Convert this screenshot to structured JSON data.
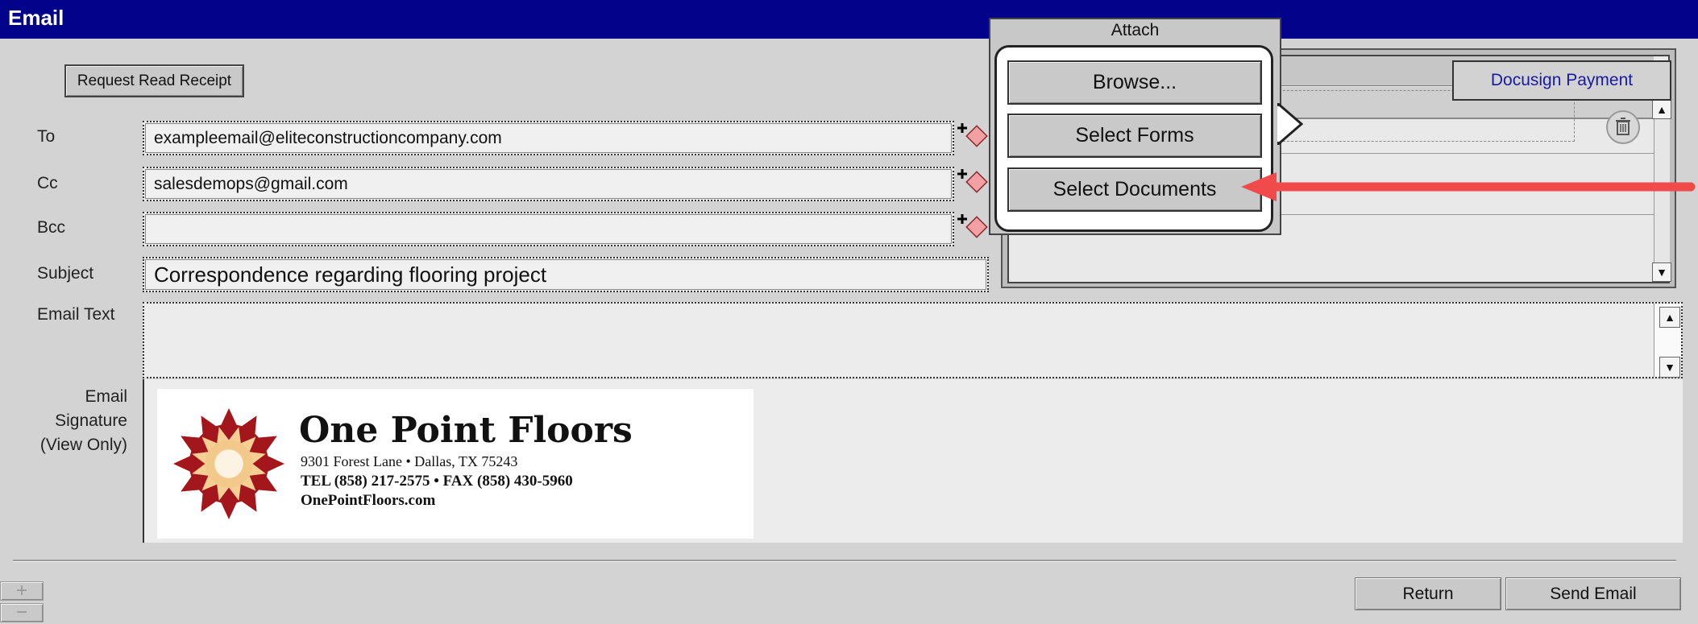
{
  "window": {
    "title": "Email"
  },
  "toolbar": {
    "read_receipt_label": "Request Read Receipt"
  },
  "fields": {
    "to": {
      "label": "To",
      "value": "exampleemail@eliteconstructioncompany.com"
    },
    "cc": {
      "label": "Cc",
      "value": "salesdemops@gmail.com"
    },
    "bcc": {
      "label": "Bcc",
      "value": ""
    },
    "subject": {
      "label": "Subject",
      "value": "Correspondence regarding flooring project"
    },
    "email_text": {
      "label": "Email Text",
      "value": ""
    }
  },
  "signature": {
    "label_line1": "Email",
    "label_line2": "Signature",
    "label_line3": "(View Only)",
    "company": "One Point Floors",
    "address": "9301 Forest Lane • Dallas, TX  75243",
    "phone_line": "TEL  (858) 217-2575 •  FAX (858) 430-5960",
    "website": "OnePointFloors.com"
  },
  "attachments": {
    "tab_label": "Docusign Payment"
  },
  "attach_popup": {
    "title": "Attach",
    "browse_label": "Browse...",
    "select_forms_label": "Select Forms",
    "select_documents_label": "Select Documents"
  },
  "footer": {
    "return_label": "Return",
    "send_label": "Send Email",
    "zoom_in": "+",
    "zoom_out": "−"
  },
  "colors": {
    "titlebar": "#02028a",
    "accent_arrow": "#f04a4a",
    "tab_text": "#1a1aa0",
    "logo_red": "#a3161b"
  },
  "icons": [
    "add-recipient-icon",
    "trash-icon",
    "scroll-up-icon",
    "scroll-down-icon",
    "sun-logo-icon"
  ]
}
